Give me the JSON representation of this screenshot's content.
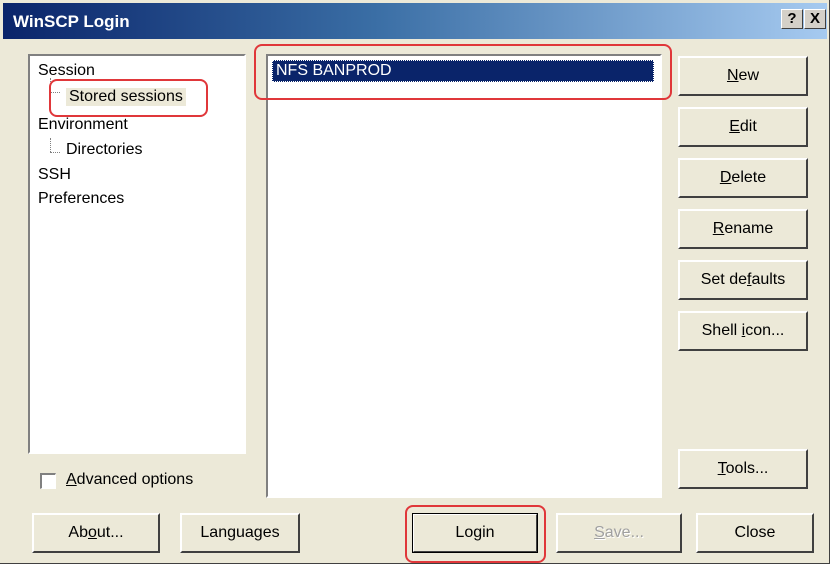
{
  "window": {
    "title": "WinSCP Login",
    "help_button": "?",
    "close_button": "X"
  },
  "tree": {
    "items": [
      {
        "label": "Session",
        "level": 0
      },
      {
        "label": "Stored sessions",
        "level": 1
      },
      {
        "label": "Environment",
        "level": 0
      },
      {
        "label": "Directories",
        "level": 1
      },
      {
        "label": "SSH",
        "level": 0
      },
      {
        "label": "Preferences",
        "level": 0
      }
    ]
  },
  "sessions": {
    "items": [
      "NFS BANPROD"
    ],
    "selected": "NFS BANPROD"
  },
  "side_buttons": {
    "new": {
      "pre": "",
      "key": "N",
      "post": "ew"
    },
    "edit": {
      "pre": "",
      "key": "E",
      "post": "dit"
    },
    "delete": {
      "pre": "",
      "key": "D",
      "post": "elete"
    },
    "rename": {
      "pre": "",
      "key": "R",
      "post": "ename"
    },
    "set_defaults": {
      "pre": "Set de",
      "key": "f",
      "post": "aults"
    },
    "shell_icon": {
      "pre": "Shell ",
      "key": "i",
      "post": "con..."
    },
    "tools": {
      "pre": "",
      "key": "T",
      "post": "ools..."
    }
  },
  "advanced": {
    "pre": "",
    "key": "A",
    "post": "dvanced options",
    "checked": false
  },
  "bottom_buttons": {
    "about": {
      "pre": "Ab",
      "key": "o",
      "post": "ut..."
    },
    "languages": {
      "pre": "Lan",
      "key": "g",
      "post": "uages"
    },
    "login": {
      "label": "Login"
    },
    "save": {
      "pre": "",
      "key": "S",
      "post": "ave...",
      "disabled": true
    },
    "close": {
      "label": "Close"
    }
  },
  "colors": {
    "title_start": "#0a246a",
    "title_end": "#a6caf0",
    "selection": "#0a246a",
    "highlight_annotation": "#e0373a",
    "dialog_face": "#ece9d8"
  }
}
